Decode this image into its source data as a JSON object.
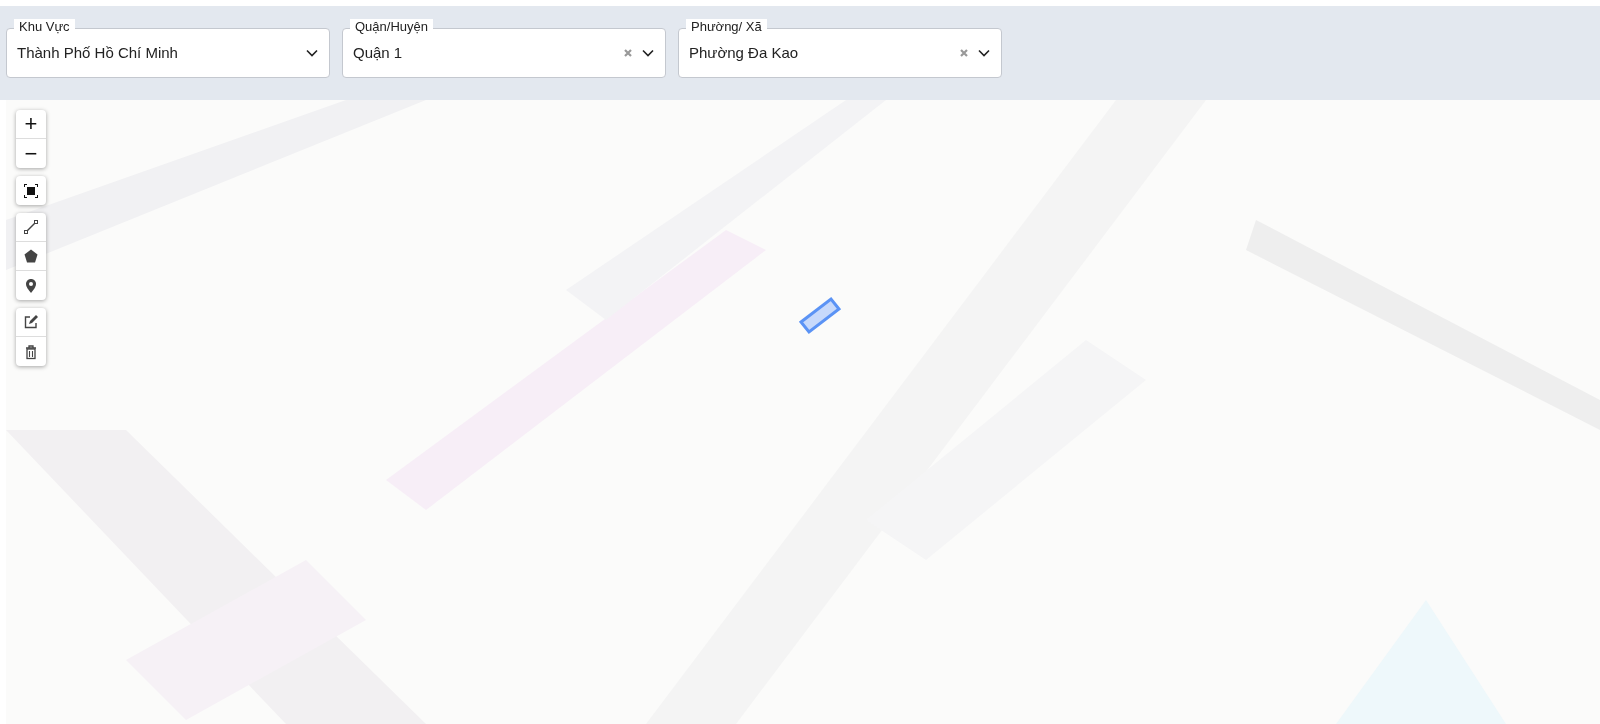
{
  "filters": [
    {
      "label": "Khu Vực",
      "value": "Thành Phố Hồ Chí Minh",
      "clearable": false
    },
    {
      "label": "Quận/Huyện",
      "value": "Quận 1",
      "clearable": true
    },
    {
      "label": "Phường/ Xã",
      "value": "Phường Đa Kao",
      "clearable": true
    }
  ],
  "map": {
    "zoom_controls": [
      "+",
      "−"
    ],
    "tools": [
      {
        "kind": "fullscreen"
      },
      {
        "kind": "line"
      },
      {
        "kind": "polygon"
      },
      {
        "kind": "marker"
      },
      {
        "kind": "edit"
      },
      {
        "kind": "delete"
      }
    ],
    "drawn_shape": {
      "kind": "rectangle"
    }
  }
}
